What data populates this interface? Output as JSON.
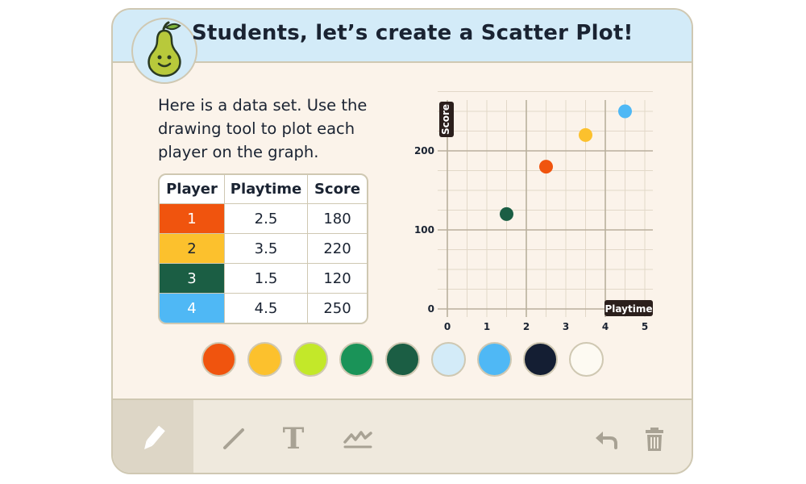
{
  "header": {
    "title": "Students, let’s create a Scatter Plot!",
    "logo_icon": "pear-logo-icon"
  },
  "instructions": "Here is a data set. Use the drawing tool to plot each player on the graph.",
  "table": {
    "headers": [
      "Player",
      "Playtime",
      "Score"
    ],
    "rows": [
      {
        "player": "1",
        "playtime": "2.5",
        "score": "180",
        "color": "#f0540e"
      },
      {
        "player": "2",
        "playtime": "3.5",
        "score": "220",
        "color": "#fcc12d"
      },
      {
        "player": "3",
        "playtime": "1.5",
        "score": "120",
        "color": "#1b5e44"
      },
      {
        "player": "4",
        "playtime": "4.5",
        "score": "250",
        "color": "#4fb8f5"
      }
    ]
  },
  "chart_data": {
    "type": "scatter",
    "xlabel": "Playtime",
    "ylabel": "Score",
    "xlim": [
      0,
      5
    ],
    "ylim": [
      0,
      250
    ],
    "x_ticks": [
      "0",
      "1",
      "2",
      "3",
      "4",
      "5"
    ],
    "y_ticks": [
      "0",
      "100",
      "200"
    ],
    "grid": true,
    "points": [
      {
        "x": 2.5,
        "y": 180,
        "color": "#f0540e"
      },
      {
        "x": 3.5,
        "y": 220,
        "color": "#fcc12d"
      },
      {
        "x": 1.5,
        "y": 120,
        "color": "#1b5e44"
      },
      {
        "x": 4.5,
        "y": 250,
        "color": "#4fb8f5"
      }
    ]
  },
  "palette": [
    "#f0540e",
    "#fcc12d",
    "#c3e829",
    "#1a9358",
    "#1b5e44",
    "#d3ebf8",
    "#4fb8f5",
    "#141e33",
    "#fdfaf2"
  ],
  "toolbar": {
    "tools": [
      "pencil-icon",
      "line-icon",
      "text-icon",
      "scribble-icon"
    ],
    "actions": [
      "undo-icon",
      "trash-icon"
    ],
    "text_tool_glyph": "T"
  }
}
